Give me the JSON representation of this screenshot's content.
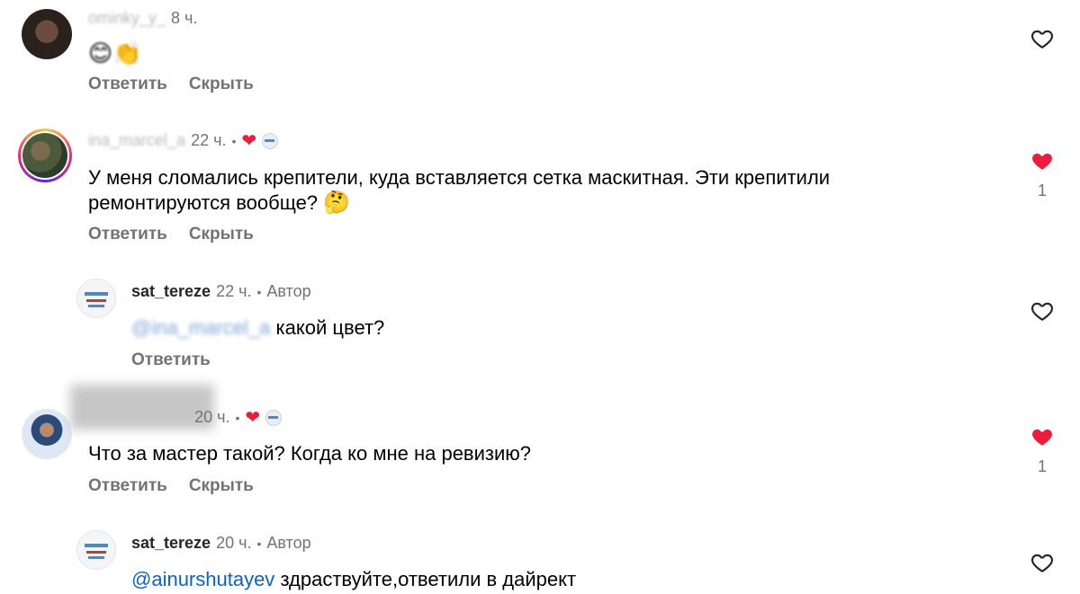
{
  "comments": [
    {
      "username": "ominky_y_",
      "time": "8 ч.",
      "text": "😊👏",
      "reply_label": "Ответить",
      "hide_label": "Скрыть",
      "liked": false,
      "like_count": ""
    },
    {
      "username": "ina_marcel_a",
      "time": "22 ч.",
      "separator": "•",
      "text_line1": "У меня сломались крепители, куда вставляется сетка маскитная.  Эти крепитили",
      "text_line2": "ремонтируются вообще?",
      "emoji": "🤔",
      "reply_label": "Ответить",
      "hide_label": "Скрыть",
      "liked": true,
      "like_count": "1"
    },
    {
      "username": "sat_tereze",
      "time": "22 ч.",
      "separator": "•",
      "author_badge": "Автор",
      "mention": "@ina_marcel_a",
      "text": "какой цвет?",
      "reply_label": "Ответить",
      "liked": false
    },
    {
      "username": "ainurshutayev",
      "time": "20 ч.",
      "separator": "•",
      "text": "Что за мастер такой?  Когда ко мне на ревизию?",
      "reply_label": "Ответить",
      "hide_label": "Скрыть",
      "liked": true,
      "like_count": "1"
    },
    {
      "username": "sat_tereze",
      "time": "20 ч.",
      "separator": "•",
      "author_badge": "Автор",
      "mention": "@ainurshutayev",
      "text": "здраствуйте,ответили в дайрект",
      "liked": false
    }
  ],
  "colors": {
    "heart_liked": "#ed1c3c",
    "mention": "#0b63c7",
    "secondary_text": "#737373"
  }
}
